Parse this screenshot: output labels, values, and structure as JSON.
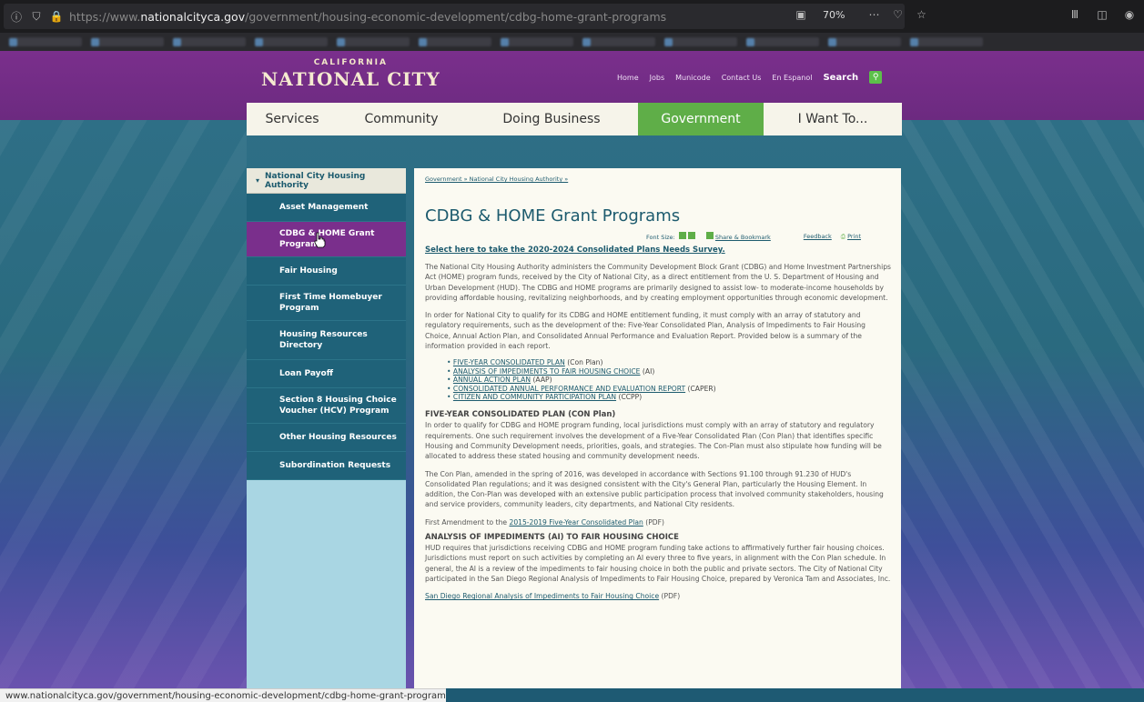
{
  "browser": {
    "url_prefix": "https://www.",
    "url_domain": "nationalcityca.gov",
    "url_path": "/government/housing-economic-development/cdbg-home-grant-programs",
    "zoom": "70%",
    "status_url": "www.nationalcityca.gov/government/housing-economic-development/cdbg-home-grant-programs"
  },
  "header": {
    "logo_small": "CALIFORNIA",
    "logo_big": "NATIONAL CITY",
    "links": [
      "Home",
      "Jobs",
      "Municode",
      "Contact Us",
      "En Espanol"
    ],
    "search_label": "Search"
  },
  "nav": {
    "items": [
      "Services",
      "Community",
      "Doing Business",
      "Government",
      "I Want To..."
    ],
    "active": "Government"
  },
  "sidebar": {
    "heading": "National City Housing Authority",
    "items": [
      "Asset Management",
      "CDBG & HOME Grant Programs",
      "Fair Housing",
      "First Time Homebuyer Program",
      "Housing Resources Directory",
      "Loan Payoff",
      "Section 8 Housing Choice Voucher (HCV) Program",
      "Other Housing Resources",
      "Subordination Requests"
    ],
    "active": "CDBG & HOME Grant Programs"
  },
  "content": {
    "breadcrumb": "Government » National City Housing Authority »",
    "title": "CDBG & HOME Grant Programs",
    "font_size_label": "Font Size:",
    "share_label": "Share & Bookmark",
    "feedback_label": "Feedback",
    "print_label": "Print",
    "survey_link": "Select here to take the 2020-2024 Consolidated Plans Needs Survey.",
    "intro1": "The National City Housing Authority administers the Community Development Block Grant (CDBG) and Home Investment Partnerships Act (HOME) program funds, received by the City of National City, as a direct entitlement from the U. S. Department of Housing and Urban Development (HUD). The CDBG and HOME programs are primarily designed to assist low- to moderate-income households by providing affordable housing, revitalizing neighborhoods, and by creating employment opportunities through economic development.",
    "intro2": "In order for National City to qualify for its CDBG and HOME entitlement funding, it must comply with an array of statutory and regulatory requirements, such as the development of the: Five-Year Consolidated Plan, Analysis of Impediments to Fair Housing Choice, Annual Action Plan, and Consolidated Annual Performance and Evaluation Report. Provided below is a summary of the information provided in each report.",
    "plans": [
      {
        "link": "FIVE-YEAR CONSOLIDATED PLAN",
        "abbr": "(Con Plan)"
      },
      {
        "link": "ANALYSIS OF IMPEDIMENTS TO FAIR HOUSING CHOICE",
        "abbr": "(AI)"
      },
      {
        "link": "ANNUAL ACTION PLAN",
        "abbr": "(AAP)"
      },
      {
        "link": "CONSOLIDATED ANNUAL PERFORMANCE AND EVALUATION REPORT",
        "abbr": "(CAPER)"
      },
      {
        "link": "CITIZEN AND COMMUNITY PARTICIPATION PLAN",
        "abbr": "(CCPP)"
      }
    ],
    "sec1_title": "FIVE-YEAR CONSOLIDATED PLAN (CON Plan)",
    "sec1_p1": "In order to qualify for CDBG and HOME program funding, local jurisdictions must comply with an array of statutory and regulatory requirements.  One such requirement involves the development of a Five-Year Consolidated Plan (Con Plan) that identifies specific Housing and Community Development needs, priorities, goals, and strategies.  The Con-Plan must also stipulate how funding will be allocated to address these stated housing and community development needs.",
    "sec1_p2": "The Con Plan, amended in the spring of 2016, was developed in accordance with Sections 91.100 through 91.230 of HUD's Consolidated Plan regulations; and it was designed consistent with the City's General Plan, particularly the Housing Element.  In addition, the Con-Plan was developed with an extensive public participation process that involved community stakeholders, housing and service providers, community leaders, city departments, and National City residents.",
    "amend_prefix": "First Amendment to the ",
    "amend_link": "2015-2019 Five-Year Consolidated Plan",
    "amend_suffix": " (PDF)",
    "sec2_title": "ANALYSIS OF IMPEDIMENTS (AI) TO FAIR HOUSING CHOICE",
    "sec2_p1": "HUD requires that jurisdictions receiving CDBG and HOME program funding take actions to affirmatively further fair housing choices.  Jurisdictions must report on such activities by completing an AI every three to five years, in alignment with the Con Plan schedule.  In general, the AI is a review of the impediments to fair housing choice in both the public and private sectors.  The City of National City participated in the San Diego Regional Analysis of Impediments to Fair Housing Choice, prepared by Veronica Tam and Associates, Inc.",
    "regional_link": "San Diego Regional Analysis of Impediments to Fair Housing Choice",
    "regional_suffix": " (PDF)"
  }
}
